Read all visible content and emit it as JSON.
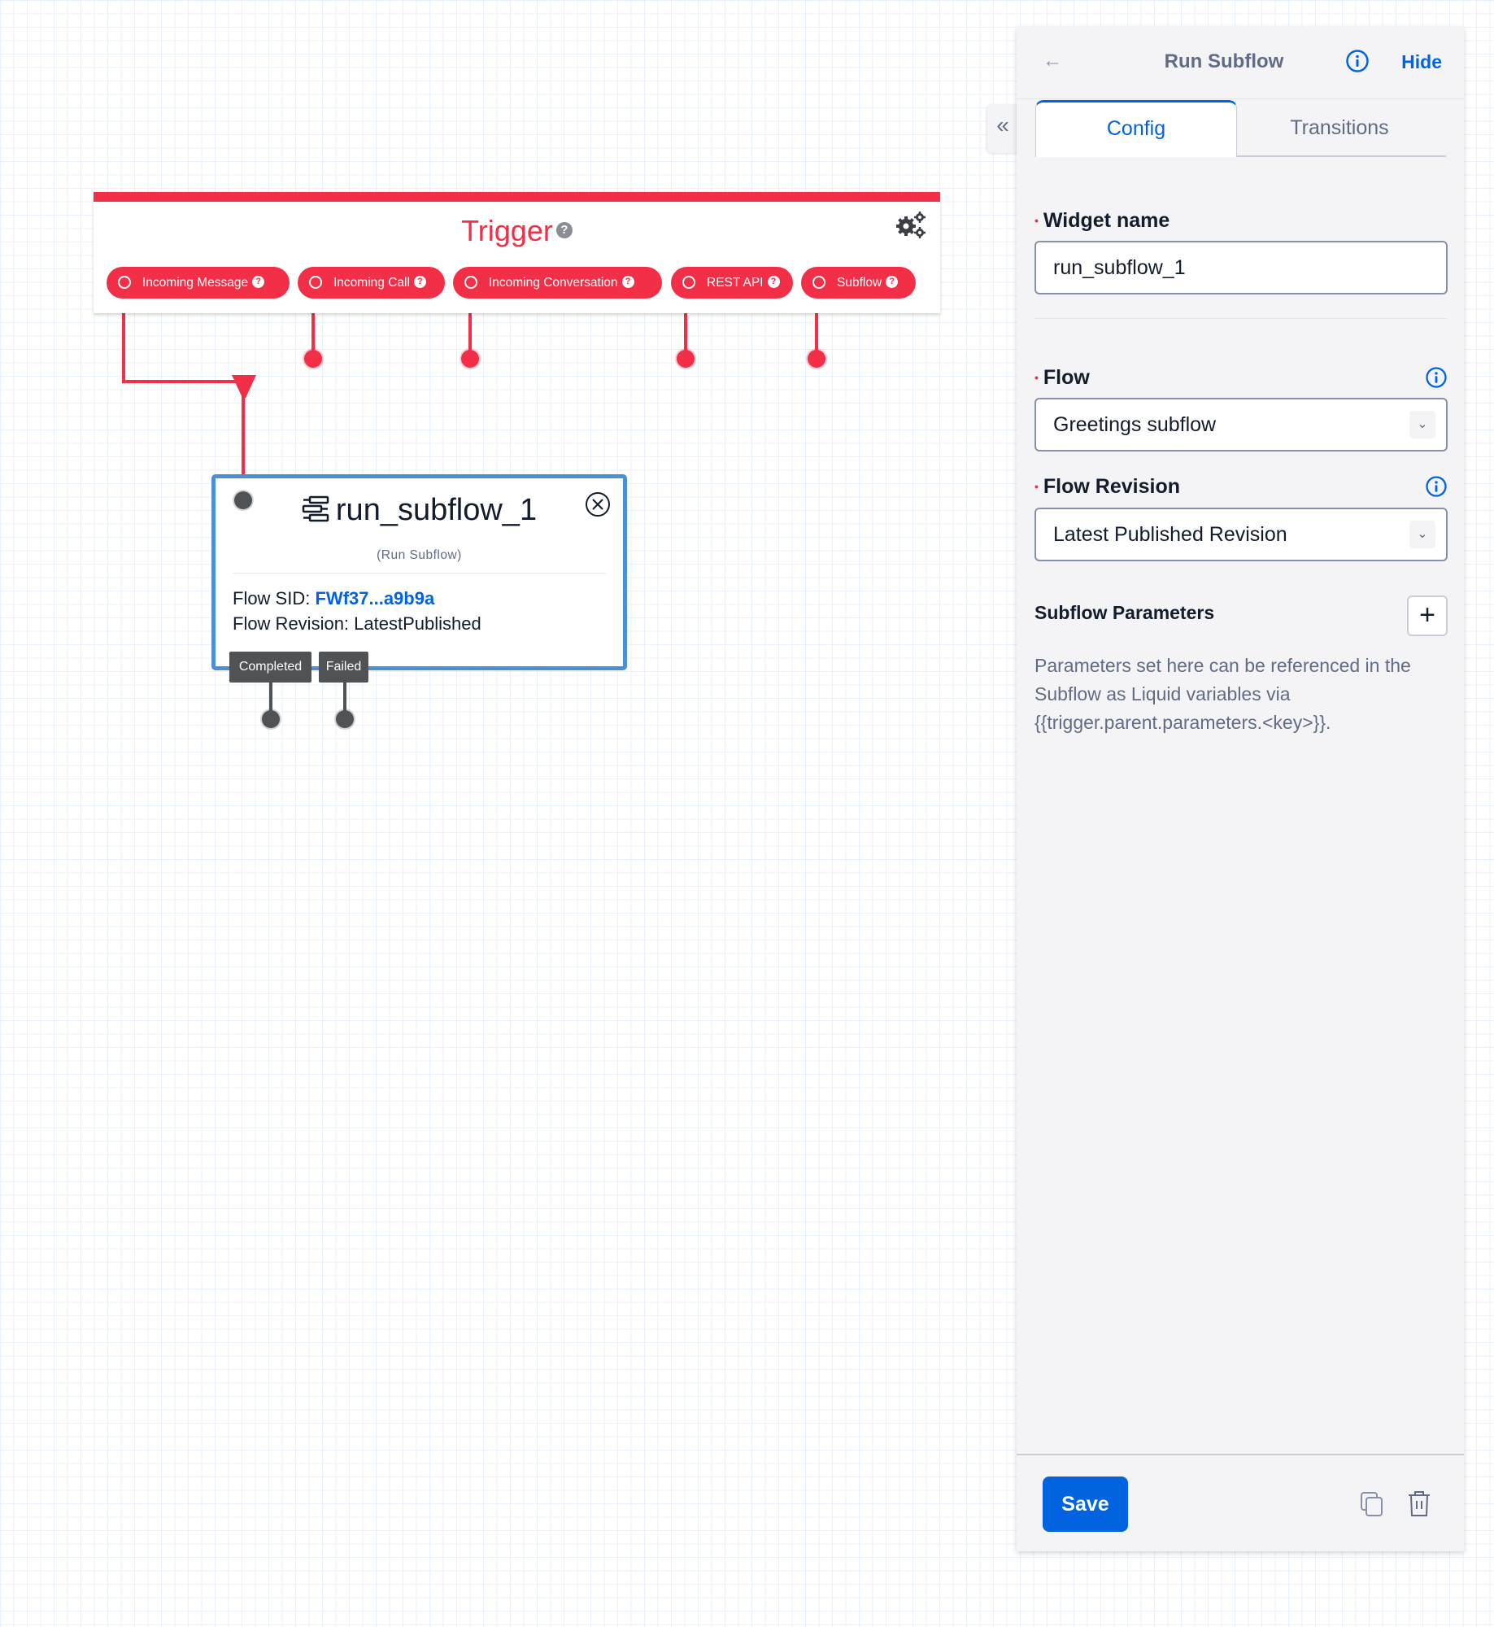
{
  "canvas": {
    "trigger": {
      "title": "Trigger",
      "help_glyph": "?",
      "settings_icon": "gears-icon",
      "accent_color": "#f22f46",
      "pills": [
        {
          "label": "Incoming Message",
          "help_glyph": "?"
        },
        {
          "label": "Incoming Call",
          "help_glyph": "?"
        },
        {
          "label": "Incoming Conversation",
          "help_glyph": "?"
        },
        {
          "label": "REST API",
          "help_glyph": "?"
        },
        {
          "label": "Subflow",
          "help_glyph": "?"
        }
      ]
    },
    "node": {
      "icon": "subflow-icon",
      "title": "run_subflow_1",
      "subtitle": "(Run Subflow)",
      "flow_sid_label": "Flow SID:",
      "flow_sid_value": "FWf37...a9b9a",
      "flow_revision_label": "Flow Revision:",
      "flow_revision_value": "LatestPublished",
      "border_color": "#4a90d9",
      "transitions": [
        {
          "label": "Completed"
        },
        {
          "label": "Failed"
        }
      ]
    }
  },
  "panel": {
    "collapse_glyph": "«",
    "back_glyph": "←",
    "title": "Run Subflow",
    "hide_label": "Hide",
    "tabs": [
      {
        "label": "Config",
        "active": true
      },
      {
        "label": "Transitions",
        "active": false
      }
    ],
    "fields": {
      "widget_name": {
        "label": "Widget name",
        "required": true,
        "value": "run_subflow_1"
      },
      "flow": {
        "label": "Flow",
        "required": true,
        "value": "Greetings subflow",
        "has_info": true
      },
      "flow_revision": {
        "label": "Flow Revision",
        "required": true,
        "value": "Latest Published Revision",
        "has_info": true
      }
    },
    "required_glyph": "•",
    "chevron_glyph": "⌄",
    "subflow_parameters": {
      "title": "Subflow Parameters",
      "add_glyph": "+",
      "help_text": "Parameters set here can be referenced in the Subflow as Liquid variables via {{trigger.parent.parameters.<key>}}."
    },
    "footer": {
      "save_label": "Save",
      "duplicate_icon": "duplicate-icon",
      "delete_icon": "trash-icon"
    },
    "primary_color": "#0263e0"
  }
}
